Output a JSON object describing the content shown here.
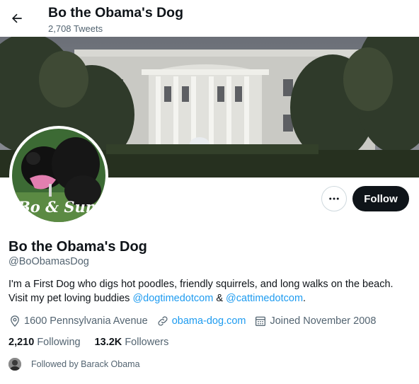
{
  "header": {
    "title": "Bo the Obama's Dog",
    "tweet_count": "2,708 Tweets"
  },
  "profile": {
    "display_name": "Bo the Obama's Dog",
    "handle": "@BoObamasDog",
    "avatar_text": "Bo & Sunny",
    "bio_line1": "I'm a First Dog who digs hot poodles, friendly squirrels, and long walks on the beach.",
    "bio_line2_prefix": "Visit my pet loving buddies ",
    "bio_link1": "@dogtimedotcom",
    "bio_between": " & ",
    "bio_link2": "@cattimedotcom",
    "bio_suffix": ".",
    "location": "1600 Pennsylvania Avenue",
    "website": "obama-dog.com",
    "joined": "Joined November 2008"
  },
  "stats": {
    "following_count": "2,210",
    "following_label": "Following",
    "followers_count": "13.2K",
    "followers_label": "Followers"
  },
  "followed_by": "Followed by Barack Obama",
  "actions": {
    "follow_label": "Follow"
  },
  "colors": {
    "accent": "#1d9bf0",
    "text_primary": "#0f1419",
    "text_secondary": "#536471"
  },
  "icons": {
    "back": "arrow-left-icon",
    "more": "more-horizontal-icon",
    "location": "location-pin-icon",
    "website": "link-icon",
    "joined": "calendar-icon"
  }
}
